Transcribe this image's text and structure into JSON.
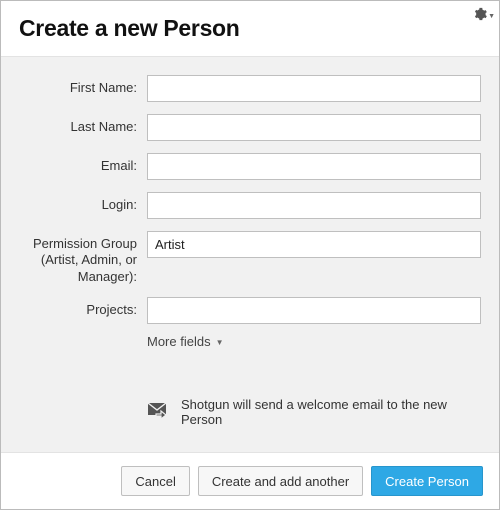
{
  "header": {
    "title": "Create a new Person"
  },
  "fields": {
    "first_name": {
      "label": "First Name:",
      "value": ""
    },
    "last_name": {
      "label": "Last Name:",
      "value": ""
    },
    "email": {
      "label": "Email:",
      "value": ""
    },
    "login": {
      "label": "Login:",
      "value": ""
    },
    "permission_group": {
      "label": "Permission Group (Artist, Admin, or Manager):",
      "value": "Artist"
    },
    "projects": {
      "label": "Projects:",
      "value": ""
    }
  },
  "more_fields_label": "More fields",
  "notice": "Shotgun will send a welcome email to the new Person",
  "buttons": {
    "cancel": "Cancel",
    "create_another": "Create and add another",
    "create": "Create Person"
  },
  "icons": {
    "gear": "gear-icon",
    "mail": "mail-forward-icon"
  }
}
